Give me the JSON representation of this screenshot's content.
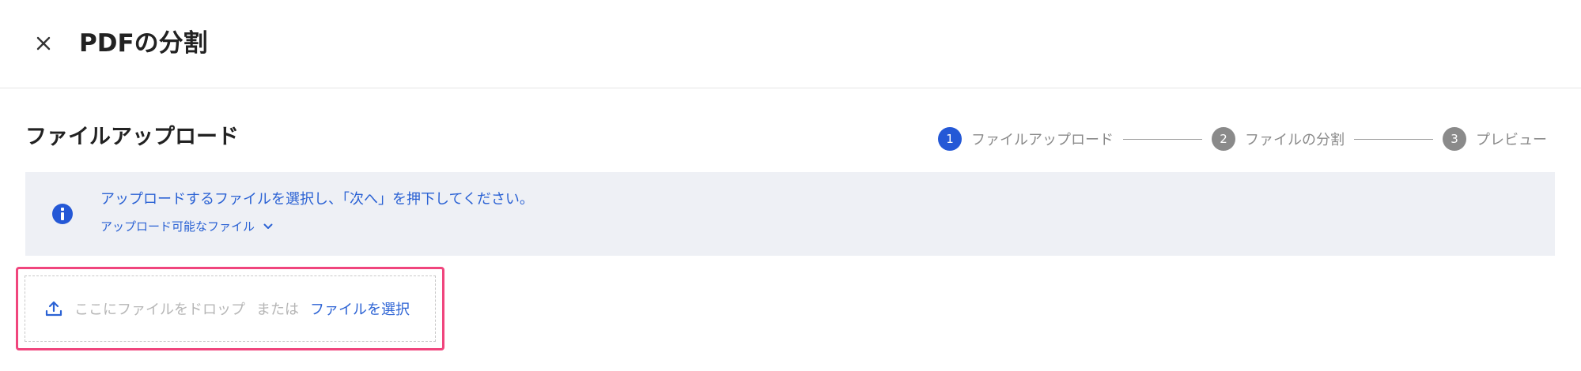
{
  "header": {
    "close_icon": "close-icon",
    "title": "PDFの分割"
  },
  "section": {
    "title": "ファイルアップロード"
  },
  "stepper": {
    "steps": [
      {
        "number": "1",
        "label": "ファイルアップロード",
        "state": "active"
      },
      {
        "number": "2",
        "label": "ファイルの分割",
        "state": "inactive"
      },
      {
        "number": "3",
        "label": "プレビュー",
        "state": "inactive"
      }
    ],
    "active_color": "#2458d6",
    "inactive_color": "#8a8a8a"
  },
  "info": {
    "icon": "info-icon",
    "message": "アップロードするファイルを選択し、「次へ」を押下してください。",
    "link_label": "アップロード可能なファイル",
    "link_icon": "chevron-down-icon",
    "background": "#eef0f5",
    "text_color": "#2b62d4"
  },
  "dropzone": {
    "icon": "upload-icon",
    "drop_text": "ここにファイルをドロップ",
    "or_text": "または",
    "select_label": "ファイルを選択",
    "highlight_color": "#f0457d"
  }
}
